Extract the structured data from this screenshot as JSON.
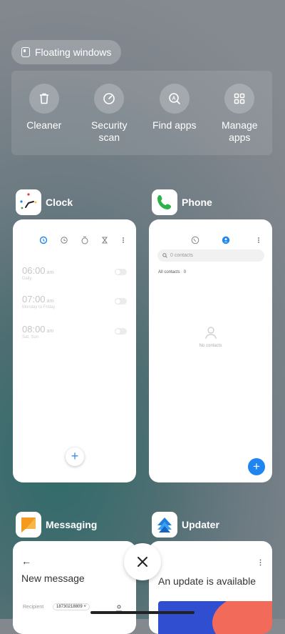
{
  "floating_windows": {
    "label": "Floating windows"
  },
  "tools": [
    {
      "label": "Cleaner",
      "icon": "trash-icon"
    },
    {
      "label": "Security scan",
      "icon": "gauge-icon"
    },
    {
      "label": "Find apps",
      "icon": "search-apps-icon"
    },
    {
      "label": "Manage apps",
      "icon": "grid-icon"
    }
  ],
  "clock": {
    "title": "Clock",
    "alarms": [
      {
        "time": "06:00",
        "ampm": "am",
        "repeat": "Daily"
      },
      {
        "time": "07:00",
        "ampm": "am",
        "repeat": "Monday to Friday"
      },
      {
        "time": "08:00",
        "ampm": "am",
        "repeat": "Sat, Sun"
      }
    ],
    "fab": "+"
  },
  "phone": {
    "title": "Phone",
    "search_placeholder": "0 contacts",
    "all_contacts": "All contacts",
    "count": "0",
    "empty": "No contacts",
    "fab": "+"
  },
  "messaging": {
    "title": "Messaging",
    "heading": "New message",
    "recipient_label": "Recipient",
    "recipient_value": "18730218809"
  },
  "updater": {
    "title": "Updater",
    "heading": "An update is available"
  },
  "colors": {
    "accent_blue": "#1f86f0",
    "phone_green": "#2db24a",
    "messaging_orange": "#f59a1f"
  }
}
